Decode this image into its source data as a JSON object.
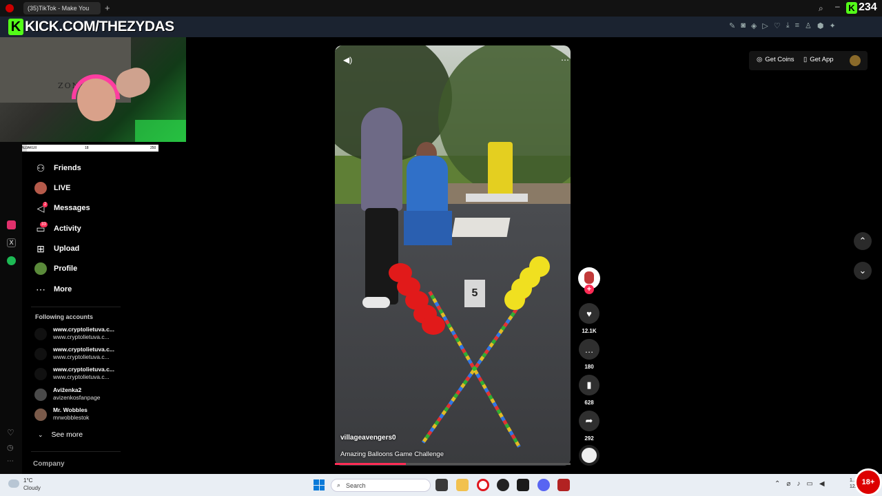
{
  "browser": {
    "tab_title": "(35)TikTok - Make You",
    "tab_add": "+",
    "counter": "234",
    "counter_badge": "K"
  },
  "overlay": {
    "kick_logo": "K",
    "kick_banner": "KICK.COM/THEZYDAS",
    "webcam_text": "ZONE",
    "progress": {
      "label": "NAUJAKUII",
      "current": "18",
      "max": "250",
      "fraction": 0.072
    }
  },
  "sidebar": {
    "items": [
      {
        "label": "Friends",
        "icon": "friends-icon"
      },
      {
        "label": "LIVE",
        "icon": "live-avatar"
      },
      {
        "label": "Messages",
        "icon": "messages-icon",
        "badge": "2"
      },
      {
        "label": "Activity",
        "icon": "activity-icon",
        "badge": "33"
      },
      {
        "label": "Upload",
        "icon": "upload-icon"
      },
      {
        "label": "Profile",
        "icon": "profile-avatar"
      },
      {
        "label": "More",
        "icon": "more-icon"
      }
    ],
    "following_title": "Following accounts",
    "accounts": [
      {
        "name": "www.cryptolietuva.c...",
        "handle": "www.cryptolietuva.c..."
      },
      {
        "name": "www.cryptolietuva.c...",
        "handle": "www.cryptolietuva.c..."
      },
      {
        "name": "www.cryptolietuva.c...",
        "handle": "www.cryptolietuva.c..."
      },
      {
        "name": "Aviženka2",
        "handle": "avizenkosfanpage"
      },
      {
        "name": "Mr. Wobbles",
        "handle": "mrwobblestok"
      }
    ],
    "see_more": "See more",
    "company": "Company"
  },
  "video": {
    "author": "villageavengers0",
    "caption": "Amazing Balloons Game Challenge",
    "box_number": "5",
    "progress_fraction": 0.3,
    "actions": {
      "likes": "12.1K",
      "comments": "180",
      "saves": "628",
      "shares": "292"
    }
  },
  "header_right": {
    "get_coins": "Get Coins",
    "get_app": "Get App"
  },
  "taskbar": {
    "weather_temp": "1°C",
    "weather_desc": "Cloudy",
    "search_placeholder": "Search",
    "time": "1...",
    "date": "12/..",
    "age_badge": "18+"
  },
  "colors": {
    "kick_green": "#53fc18",
    "tiktok_red": "#fe2c55",
    "taskbar": "#e9eef4"
  }
}
